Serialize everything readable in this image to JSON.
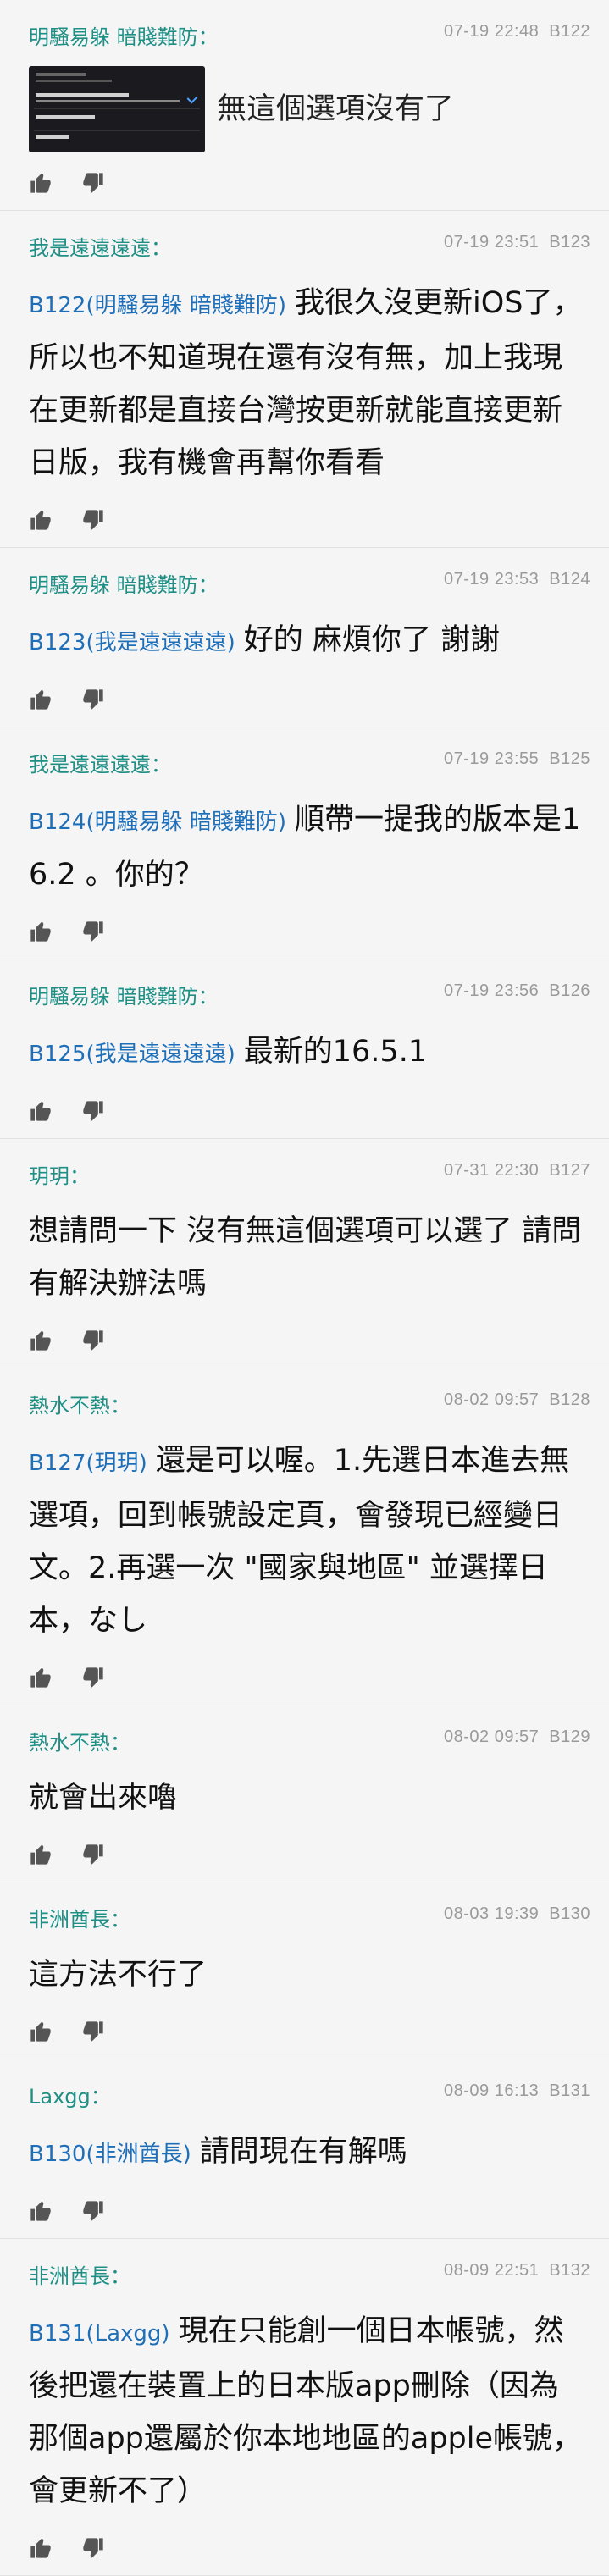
{
  "comments": [
    {
      "author": "明騷易躲 暗賤難防：",
      "time": "07-19 22:48",
      "floor": "B122",
      "reply_tag": "",
      "text": "無這個選項沒有了",
      "has_image": true
    },
    {
      "author": "我是遠遠遠遠：",
      "time": "07-19 23:51",
      "floor": "B123",
      "reply_tag": "B122(明騷易躲 暗賤難防)",
      "text": "我很久沒更新iOS了，所以也不知道現在還有沒有無，加上我現在更新都是直接台灣按更新就能直接更新日版，我有機會再幫你看看",
      "has_image": false
    },
    {
      "author": "明騷易躲 暗賤難防：",
      "time": "07-19 23:53",
      "floor": "B124",
      "reply_tag": "B123(我是遠遠遠遠)",
      "text": "好的 麻煩你了 謝謝",
      "has_image": false
    },
    {
      "author": "我是遠遠遠遠：",
      "time": "07-19 23:55",
      "floor": "B125",
      "reply_tag": "B124(明騷易躲 暗賤難防)",
      "text": "順帶一提我的版本是16.2 。你的？",
      "has_image": false
    },
    {
      "author": "明騷易躲 暗賤難防：",
      "time": "07-19 23:56",
      "floor": "B126",
      "reply_tag": "B125(我是遠遠遠遠)",
      "text": "最新的16.5.1",
      "has_image": false
    },
    {
      "author": "玥玥：",
      "time": "07-31 22:30",
      "floor": "B127",
      "reply_tag": "",
      "text": "想請問一下 沒有無這個選項可以選了 請問有解決辦法嗎",
      "has_image": false
    },
    {
      "author": "熱水不熱：",
      "time": "08-02 09:57",
      "floor": "B128",
      "reply_tag": "B127(玥玥)",
      "text": "還是可以喔。1.先選日本進去無選項，回到帳號設定頁，會發現已經變日文。2.再選一次 \"國家與地區\" 並選擇日本，なし",
      "has_image": false
    },
    {
      "author": "熱水不熱：",
      "time": "08-02 09:57",
      "floor": "B129",
      "reply_tag": "",
      "text": "就會出來嚕",
      "has_image": false
    },
    {
      "author": "非洲酋長：",
      "time": "08-03 19:39",
      "floor": "B130",
      "reply_tag": "",
      "text": "這方法不行了",
      "has_image": false
    },
    {
      "author": "Laxgg：",
      "time": "08-09 16:13",
      "floor": "B131",
      "reply_tag": "B130(非洲酋長)",
      "text": "請問現在有解嗎",
      "has_image": false
    },
    {
      "author": "非洲酋長：",
      "time": "08-09 22:51",
      "floor": "B132",
      "reply_tag": "B131(Laxgg)",
      "text": "現在只能創一個日本帳號，然後把還在裝置上的日本版app刪除（因為那個app還屬於你本地地區的apple帳號，會更新不了）",
      "has_image": false
    }
  ],
  "icons": {
    "like": "thumbs-up-icon",
    "dislike": "thumbs-down-icon"
  },
  "colors": {
    "author": "#1f8f86",
    "reply_tag": "#1f6fb8",
    "meta": "#9a9a9a",
    "background": "#f5f5f5"
  }
}
